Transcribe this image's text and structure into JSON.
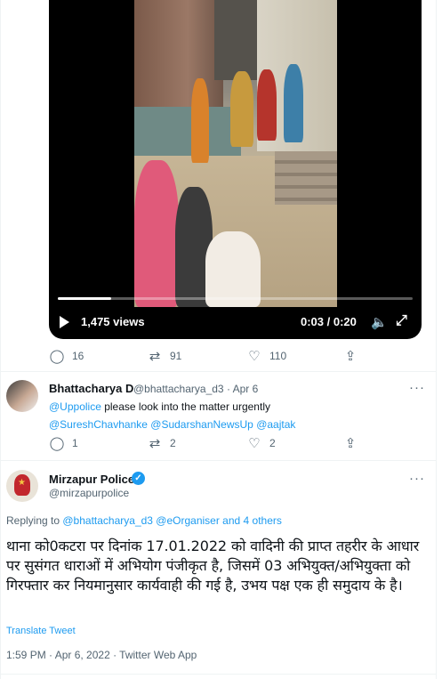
{
  "video": {
    "views": "1,475 views",
    "time": "0:03 / 0:20",
    "progress": 0.15
  },
  "original_actions": {
    "replies": "16",
    "retweets": "91",
    "likes": "110"
  },
  "reply_tweet": {
    "name": "Bhattacharya D",
    "handle": "@bhattacharya_d3",
    "date": "· Apr 6",
    "mention1": "@Uppolice",
    "text": " please look into the matter urgently",
    "mention2": "@SureshChavhanke",
    "mention3": "@SudarshanNewsUp",
    "mention4": "@aajtak",
    "replies": "1",
    "retweets": "2",
    "likes": "2"
  },
  "main_tweet": {
    "name": "Mirzapur Police",
    "handle": "@mirzapurpolice",
    "replying_prefix": "Replying to ",
    "replying_links": "@bhattacharya_d3 @eOrganiser and 4 others",
    "text": "थाना को0कटरा पर दिनांक 17.01.2022 को वादिनी की प्राप्त तहरीर के आधार पर सुसंगत धाराओं में अभियोग पंजीकृत है, जिसमें 03 अभियुक्त/अभियुक्ता को गिरफ्तार कर नियमानुसार कार्यवाही की गई है, उभय पक्ष एक ही समुदाय के है।",
    "translate": "Translate Tweet",
    "meta": "1:59 PM · Apr 6, 2022 · Twitter Web App"
  },
  "icons": {
    "reply": "reply-icon",
    "retweet": "retweet-icon",
    "like": "like-icon",
    "share": "share-icon",
    "more": "more-icon",
    "play": "play-icon",
    "volume": "volume-icon",
    "fullscreen": "fullscreen-icon",
    "verified": "verified-icon"
  },
  "colors": {
    "accent": "#1d9bf0",
    "muted": "#536471",
    "text": "#0f1419"
  }
}
